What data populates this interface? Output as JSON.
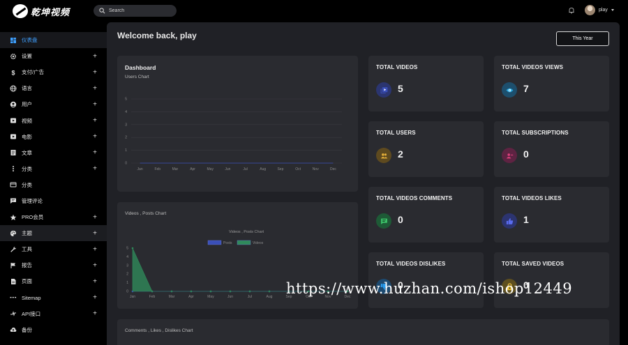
{
  "app": {
    "logo_text": "乾坤视频"
  },
  "search": {
    "placeholder": "Search"
  },
  "user": {
    "name": "play"
  },
  "sidebar": {
    "items": [
      {
        "label": "仪表盘",
        "icon": "dashboard-icon",
        "plus": ""
      },
      {
        "label": "设置",
        "icon": "gear-icon",
        "plus": "+"
      },
      {
        "label": "支付/广告",
        "icon": "dollar-icon",
        "plus": "+"
      },
      {
        "label": "语言",
        "icon": "globe-icon",
        "plus": "+"
      },
      {
        "label": "用户",
        "icon": "user-icon",
        "plus": "+"
      },
      {
        "label": "视频",
        "icon": "video-icon",
        "plus": "+"
      },
      {
        "label": "电影",
        "icon": "movie-icon",
        "plus": "+"
      },
      {
        "label": "文章",
        "icon": "article-icon",
        "plus": "+"
      },
      {
        "label": "分类",
        "icon": "more-vertical-icon",
        "plus": "+"
      },
      {
        "label": "分类",
        "icon": "card-icon",
        "plus": ""
      },
      {
        "label": "管理评论",
        "icon": "comment-icon",
        "plus": ""
      },
      {
        "label": "PRO会员",
        "icon": "star-icon",
        "plus": "+"
      },
      {
        "label": "主题",
        "icon": "palette-icon",
        "plus": "+"
      },
      {
        "label": "工具",
        "icon": "wrench-icon",
        "plus": "+"
      },
      {
        "label": "报告",
        "icon": "flag-icon",
        "plus": "+"
      },
      {
        "label": "页面",
        "icon": "page-icon",
        "plus": "+"
      },
      {
        "label": "Sitemap",
        "icon": "sitemap-icon",
        "plus": "+"
      },
      {
        "label": "API接口",
        "icon": "api-icon",
        "plus": "+"
      },
      {
        "label": "备份",
        "icon": "cloud-upload-icon",
        "plus": ""
      }
    ]
  },
  "main": {
    "welcome": "Welcome back, play",
    "year_button": "This Year"
  },
  "dashboard_card": {
    "title": "Dashboard",
    "subtitle": "Users Chart"
  },
  "videos_posts_card": {
    "title": "Videos , Posts Chart"
  },
  "comments_card": {
    "title": "Comments , Likes , Dislikes Chart"
  },
  "stats": [
    {
      "title": "TOTAL VIDEOS",
      "value": "5",
      "icon": "video-library-icon",
      "color": "#3a4fb8",
      "iconbg": "#2b3570"
    },
    {
      "title": "TOTAL VIDEOS VIEWS",
      "value": "7",
      "icon": "eye-icon",
      "color": "#29a8e0",
      "iconbg": "#1d4f6d"
    },
    {
      "title": "TOTAL USERS",
      "value": "2",
      "icon": "users-icon",
      "color": "#e8b23a",
      "iconbg": "#5e4a1f"
    },
    {
      "title": "TOTAL SUBSCRIPTIONS",
      "value": "0",
      "icon": "subscriptions-icon",
      "color": "#e0407e",
      "iconbg": "#5e2342"
    },
    {
      "title": "TOTAL VIDEOS COMMENTS",
      "value": "0",
      "icon": "comment-icon",
      "color": "#3cc46a",
      "iconbg": "#1e5a36"
    },
    {
      "title": "TOTAL VIDEOS LIKES",
      "value": "1",
      "icon": "thumbs-up-icon",
      "color": "#5a6cf0",
      "iconbg": "#2c3470"
    },
    {
      "title": "TOTAL VIDEOS DISLIKES",
      "value": "0",
      "icon": "thumbs-down-icon",
      "color": "#2a9df0",
      "iconbg": "#1d4a70"
    },
    {
      "title": "TOTAL SAVED VIDEOS",
      "value": "0",
      "icon": "lock-icon",
      "color": "#e8c03a",
      "iconbg": "#5e4f1f"
    }
  ],
  "watermark": "https://www.huzhan.com/ishop12449",
  "chart_data": [
    {
      "type": "line",
      "title": "",
      "categories": [
        "Jan",
        "Feb",
        "Mar",
        "Apr",
        "May",
        "Jun",
        "Jul",
        "Aug",
        "Sep",
        "Oct",
        "Nov",
        "Dec"
      ],
      "y_ticks": [
        "0",
        "1",
        "2",
        "3",
        "4",
        "5"
      ],
      "ylim": [
        0,
        5
      ],
      "series": [
        {
          "values": [
            0,
            0,
            0,
            0,
            0,
            0,
            0,
            0,
            0,
            0,
            0,
            0
          ]
        }
      ],
      "grid": true
    },
    {
      "type": "area",
      "title": "Videos , Posts Chart",
      "categories": [
        "Jan",
        "Feb",
        "Mar",
        "Apr",
        "May",
        "Jun",
        "Jul",
        "Aug",
        "Sep",
        "Oct",
        "Nov",
        "Dec"
      ],
      "y_ticks": [
        "0",
        "1",
        "2",
        "3",
        "4",
        "5"
      ],
      "ylim": [
        0,
        5
      ],
      "legend": "top-center",
      "series": [
        {
          "name": "Posts",
          "color": "#3a4fb8",
          "values": [
            0,
            0,
            0,
            0,
            0,
            0,
            0,
            0,
            0,
            0,
            0,
            0
          ]
        },
        {
          "name": "Videos",
          "color": "#2f8a5a",
          "values": [
            5,
            0,
            0,
            0,
            0,
            0,
            0,
            0,
            0,
            0,
            0,
            0
          ]
        }
      ]
    }
  ]
}
